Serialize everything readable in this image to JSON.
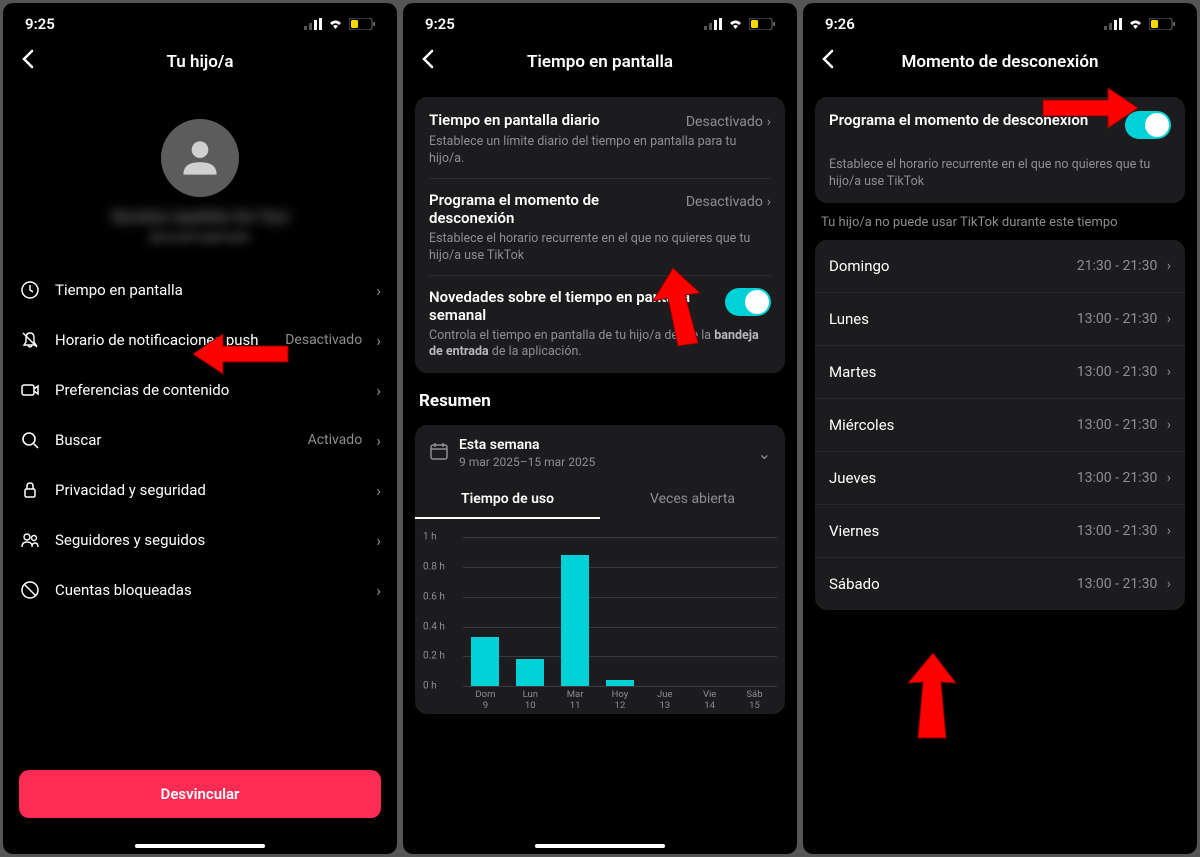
{
  "screen1": {
    "time": "9:25",
    "title": "Tu hijo/a",
    "profile_name": "Nombre Apellido De Test",
    "profile_handle": "@usuarioejemplo",
    "rows": [
      {
        "icon": "clock",
        "label": "Tiempo en pantalla",
        "status": ""
      },
      {
        "icon": "bell-off",
        "label": "Horario de notificaciones push",
        "status": "Desactivado"
      },
      {
        "icon": "video",
        "label": "Preferencias de contenido",
        "status": ""
      },
      {
        "icon": "search",
        "label": "Buscar",
        "status": "Activado"
      },
      {
        "icon": "lock",
        "label": "Privacidad y seguridad",
        "status": ""
      },
      {
        "icon": "people",
        "label": "Seguidores y seguidos",
        "status": ""
      },
      {
        "icon": "ban",
        "label": "Cuentas bloqueadas",
        "status": ""
      }
    ],
    "unlink": "Desvincular"
  },
  "screen2": {
    "time": "9:25",
    "title": "Tiempo en pantalla",
    "cards": [
      {
        "title": "Tiempo en pantalla diario",
        "status": "Desactivado",
        "desc": "Establece un límite diario del tiempo en pantalla para tu hijo/a."
      },
      {
        "title": "Programa el momento de desconexión",
        "status": "Desactivado",
        "desc": "Establece el horario recurrente en el que no quieres que tu hijo/a use TikTok"
      },
      {
        "title": "Novedades sobre el tiempo en pantalla semanal",
        "desc_pre": "Controla el tiempo en pantalla de tu hijo/a desde la ",
        "desc_bold": "bandeja de entrada",
        "desc_post": " de la aplicación."
      }
    ],
    "summary_title": "Resumen",
    "week_label": "Esta semana",
    "week_range": "9 mar 2025–15 mar 2025",
    "tab1": "Tiempo de uso",
    "tab2": "Veces abierta"
  },
  "screen3": {
    "time": "9:26",
    "title": "Momento de desconexión",
    "card_title": "Programa el momento de desconexión",
    "card_desc": "Establece el horario recurrente en el que no quieres que tu hijo/a use TikTok",
    "note": "Tu hijo/a no puede usar TikTok durante este tiempo",
    "days": [
      {
        "name": "Domingo",
        "time": "21:30 - 21:30"
      },
      {
        "name": "Lunes",
        "time": "13:00 - 21:30"
      },
      {
        "name": "Martes",
        "time": "13:00 - 21:30"
      },
      {
        "name": "Miércoles",
        "time": "13:00 - 21:30"
      },
      {
        "name": "Jueves",
        "time": "13:00 - 21:30"
      },
      {
        "name": "Viernes",
        "time": "13:00 - 21:30"
      },
      {
        "name": "Sábado",
        "time": "13:00 - 21:30"
      }
    ]
  },
  "chart_data": {
    "type": "bar",
    "title": "Tiempo de uso",
    "ylabel": "horas",
    "ylim": [
      0,
      1
    ],
    "y_ticks": [
      "1 h",
      "0.8 h",
      "0.6 h",
      "0.4 h",
      "0.2 h",
      "0 h"
    ],
    "categories": [
      "Dom 9",
      "Lun 10",
      "Mar 11",
      "Hoy 12",
      "Jue 13",
      "Vie 14",
      "Sáb 15"
    ],
    "values": [
      0.33,
      0.18,
      0.88,
      0.04,
      0,
      0,
      0
    ]
  }
}
